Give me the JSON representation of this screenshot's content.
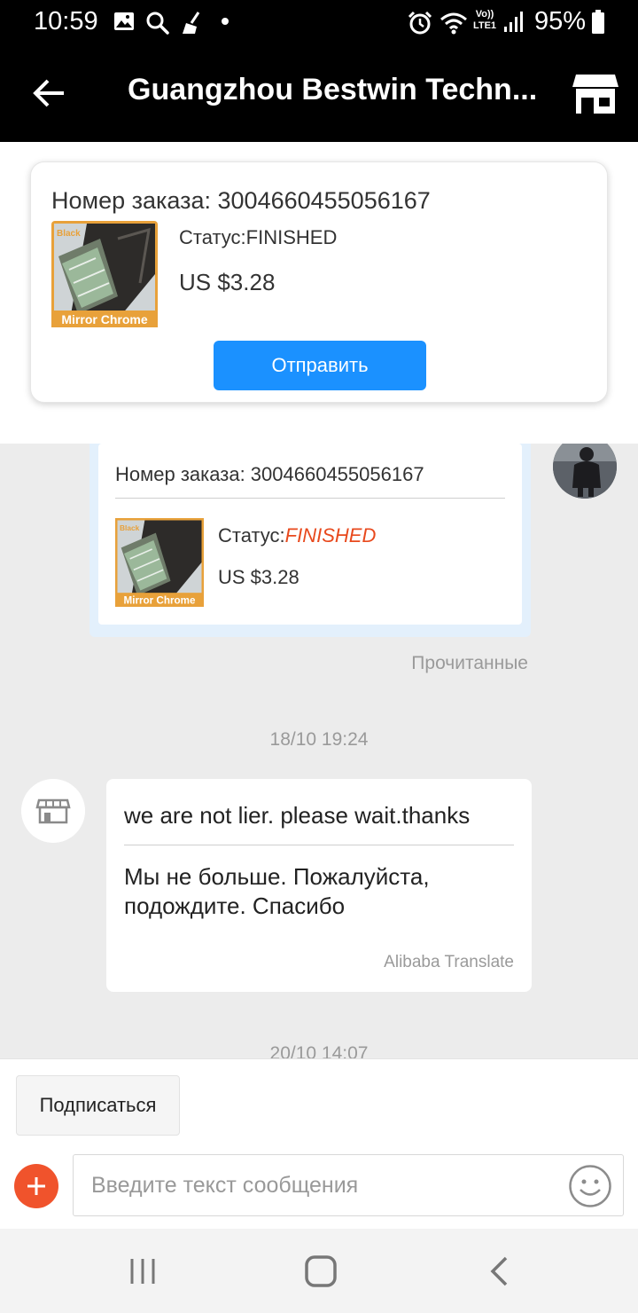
{
  "status_bar": {
    "time": "10:59",
    "battery": "95%",
    "icons": [
      "gallery-icon",
      "search-icon",
      "broom-icon",
      "dot-icon",
      "alarm-icon",
      "wifi-icon",
      "volte-icon",
      "signal-icon",
      "battery-icon"
    ],
    "volte_label": "Vo)) LTE1"
  },
  "header": {
    "title": "Guangzhou Bestwin Techn...",
    "back_icon": "back-arrow-icon",
    "store_icon": "store-icon"
  },
  "pinned_order": {
    "order_number": "Номер заказа: 3004660455056167",
    "status": "Статус:FINISHED",
    "price": "US $3.28",
    "send_label": "Отправить",
    "thumb_top_label": "Black",
    "thumb_bottom_label": "Mirror Chrome"
  },
  "chat": {
    "order_card": {
      "order_number": "Номер заказа: 3004660455056167",
      "status_label": "Статус:",
      "status_value": "FINISHED",
      "price": "US $3.28",
      "thumb_top_label": "Black",
      "thumb_bottom_label": "Mirror Chrome"
    },
    "read_status": "Прочитанные",
    "timestamp_1": "18/10 19:24",
    "message": {
      "original": "we are not lier. please wait.thanks",
      "translated": "Мы не больше. Пожалуйста, подождите. Спасибо",
      "translator": "Alibaba Translate"
    },
    "timestamp_2": "20/10 14:07"
  },
  "bottom": {
    "subscribe_label": "Подписаться",
    "input_placeholder": "Введите текст сообщения",
    "input_value": ""
  },
  "nav": {
    "icons": [
      "recent-apps-icon",
      "home-icon",
      "back-icon"
    ]
  },
  "colors": {
    "header_bg": "#000000",
    "accent_blue": "#1b91ff",
    "status_finished": "#e8491d",
    "plus_button": "#f0532c",
    "chat_bg": "#ececec"
  }
}
